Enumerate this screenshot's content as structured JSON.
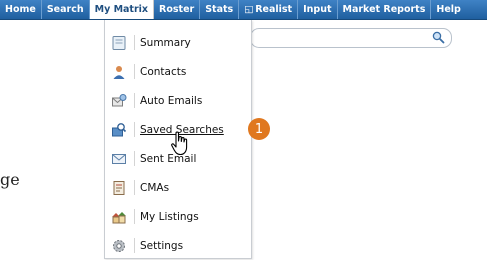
{
  "navbar": {
    "items": [
      {
        "label": "Home",
        "active": false
      },
      {
        "label": "Search",
        "active": false
      },
      {
        "label": "My Matrix",
        "active": true
      },
      {
        "label": "Roster",
        "active": false
      },
      {
        "label": "Stats",
        "active": false
      },
      {
        "label": "Realist",
        "active": false
      },
      {
        "label": "Input",
        "active": false
      },
      {
        "label": "Market Reports",
        "active": false
      },
      {
        "label": "Help",
        "active": false
      }
    ]
  },
  "search": {
    "icon": "magnifier-icon"
  },
  "dropdown": {
    "items": [
      {
        "label": "Summary",
        "icon": "document-icon"
      },
      {
        "label": "Contacts",
        "icon": "person-icon"
      },
      {
        "label": "Auto Emails",
        "icon": "auto-email-icon"
      },
      {
        "label": "Saved Searches",
        "icon": "saved-search-icon",
        "hovered": true
      },
      {
        "label": "Sent Email",
        "icon": "envelope-icon"
      },
      {
        "label": "CMAs",
        "icon": "report-icon"
      },
      {
        "label": "My Listings",
        "icon": "houses-icon"
      },
      {
        "label": "Settings",
        "icon": "gear-icon"
      }
    ]
  },
  "callout": {
    "number": "1",
    "color": "#e0781f"
  },
  "background_text": "ge",
  "colors": {
    "navbar": "#2e6fb0",
    "accent": "#e0781f"
  }
}
